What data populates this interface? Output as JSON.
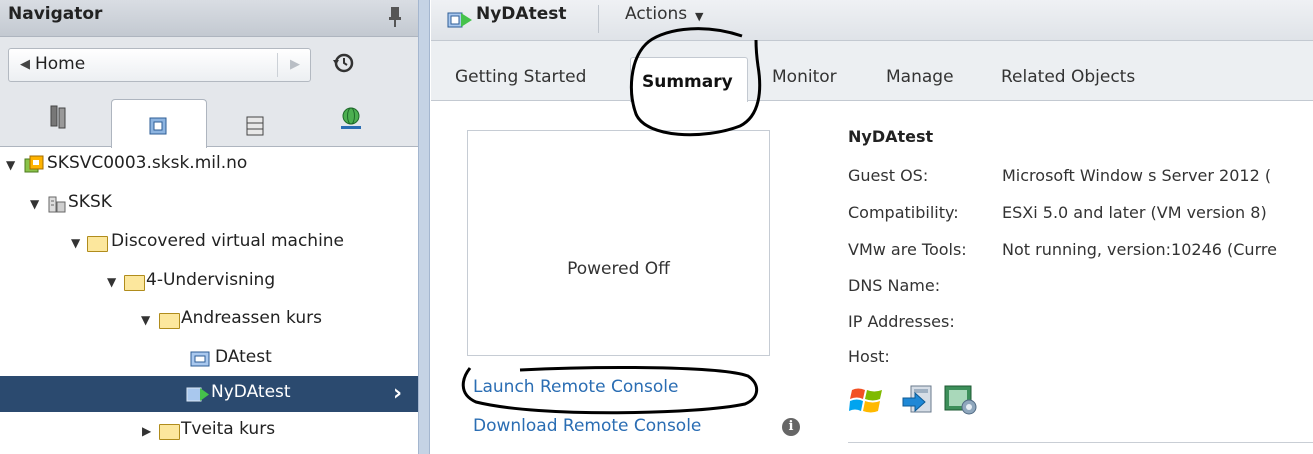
{
  "navigator": {
    "title": "Navigator",
    "home_label": "Home",
    "icons": [
      "pin-icon",
      "history-icon",
      "hosts-clusters-icon",
      "vms-templates-icon",
      "storage-icon",
      "networking-icon"
    ]
  },
  "tree": [
    {
      "label": "SKSVC0003.sksk.mil.no",
      "icon": "vcenter-icon",
      "expanded": true
    },
    {
      "label": "SKSK",
      "icon": "datacenter-icon",
      "expanded": true
    },
    {
      "label": "Discovered virtual machine",
      "icon": "folder-icon",
      "expanded": true
    },
    {
      "label": "4-Undervisning",
      "icon": "folder-icon",
      "expanded": true
    },
    {
      "label": "Andreassen kurs",
      "icon": "folder-icon",
      "expanded": true
    },
    {
      "label": "DAtest",
      "icon": "vm-icon"
    },
    {
      "label": "NyDAtest",
      "icon": "vm-icon",
      "selected": true
    },
    {
      "label": "Tveita kurs",
      "icon": "folder-icon",
      "expanded": false
    }
  ],
  "main": {
    "title": "NyDAtest",
    "actions_label": "Actions",
    "tabs": [
      {
        "label": "Getting Started"
      },
      {
        "label": "Summary",
        "active": true
      },
      {
        "label": "Monitor"
      },
      {
        "label": "Manage"
      },
      {
        "label": "Related Objects"
      }
    ],
    "console": {
      "status": "Powered Off",
      "launch_label": "Launch Remote Console",
      "download_label": "Download Remote Console"
    },
    "properties": {
      "name": "NyDAtest",
      "rows": [
        {
          "label": "Guest OS:",
          "value": "Microsoft Window s Server 2012 ("
        },
        {
          "label": "Compatibility:",
          "value": "ESXi 5.0 and later (VM version 8)"
        },
        {
          "label": "VMw are Tools:",
          "value": "Not running, version:10246 (Curre"
        },
        {
          "label": "DNS Name:",
          "value": ""
        },
        {
          "label": "IP Addresses:",
          "value": ""
        },
        {
          "label": "Host:",
          "value": ""
        }
      ]
    }
  },
  "colors": {
    "selection": "#2b4a6f",
    "link": "#2a6db3",
    "folder": "#fce79d",
    "splitter": "#c5d3e5"
  }
}
